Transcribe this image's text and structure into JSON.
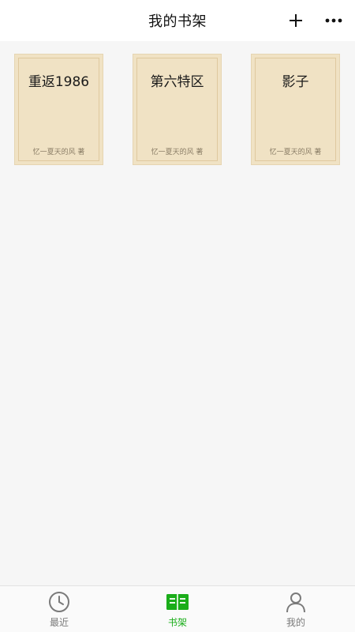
{
  "header": {
    "title": "我的书架",
    "add_icon": "plus-icon",
    "more_icon": "more-icon"
  },
  "books": [
    {
      "title": "重返1986",
      "author": "忆一夏天的风 著"
    },
    {
      "title": "第六特区",
      "author": "忆一夏天的风 著"
    },
    {
      "title": "影子",
      "author": "忆一夏天的风 著"
    }
  ],
  "tabbar": {
    "active": "书架",
    "accent": "#1aad19",
    "inactive_color": "#7a7a7a",
    "tabs": [
      {
        "label": "最近",
        "icon": "clock-icon"
      },
      {
        "label": "书架",
        "icon": "book-icon"
      },
      {
        "label": "我的",
        "icon": "user-icon"
      }
    ]
  }
}
